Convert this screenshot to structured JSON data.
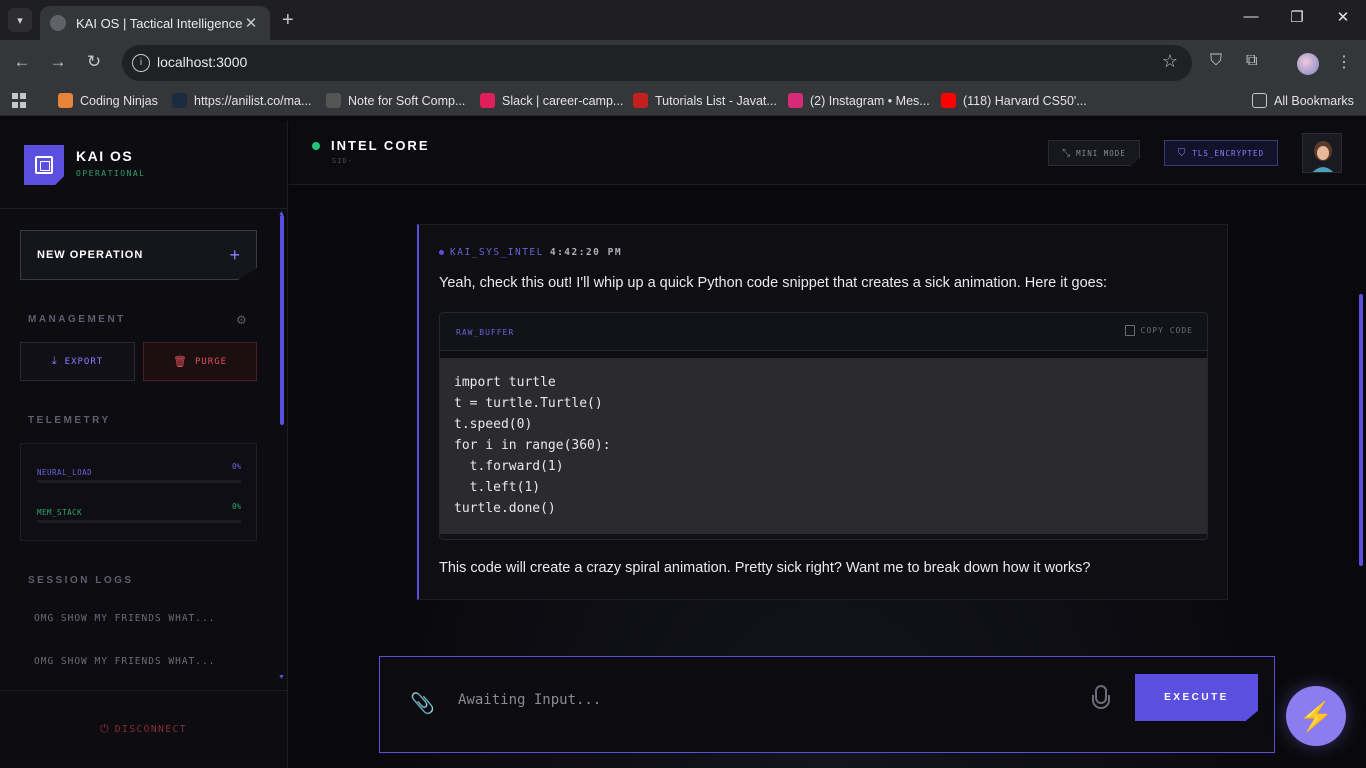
{
  "browser": {
    "tab_title": "KAI OS | Tactical Intelligence",
    "url": "localhost:3000",
    "bookmarks": [
      {
        "label": "Coding Ninjas",
        "color": "#e8833a"
      },
      {
        "label": "https://anilist.co/ma...",
        "color": "#1b2b40"
      },
      {
        "label": "Note for Soft Comp...",
        "color": "#555555"
      },
      {
        "label": "Slack | career-camp...",
        "color": "#e01e5a"
      },
      {
        "label": "Tutorials List - Javat...",
        "color": "#c21f1f"
      },
      {
        "label": "(2) Instagram • Mes...",
        "color": "#d62976"
      },
      {
        "label": "(118) Harvard CS50'...",
        "color": "#ff0000"
      }
    ],
    "all_bookmarks": "All Bookmarks"
  },
  "sidebar": {
    "brand_name": "KAI OS",
    "brand_status": "OPERATIONAL",
    "new_operation": "NEW OPERATION",
    "management_title": "MANAGEMENT",
    "export_label": "EXPORT",
    "purge_label": "PURGE",
    "telemetry_title": "TELEMETRY",
    "telemetry": [
      {
        "label": "NEURAL_LOAD",
        "value": "0%",
        "color": "#6a62d8"
      },
      {
        "label": "MEM_STACK",
        "value": "0%",
        "color": "#2fa36b"
      }
    ],
    "session_logs_title": "SESSION LOGS",
    "session_logs": [
      "OMG SHOW MY FRIENDS WHAT...",
      "OMG SHOW MY FRIENDS WHAT..."
    ],
    "disconnect": "DISCONNECT"
  },
  "header": {
    "title": "INTEL CORE",
    "subtitle": "SID-",
    "mini_mode": "MINI MODE",
    "tls": "TLS_ENCRYPTED"
  },
  "message": {
    "sender": "KAI_SYS_INTEL",
    "time": "4:42:20 PM",
    "intro": "Yeah, check this out! I'll whip up a quick Python code snippet that creates a sick animation. Here it goes:",
    "code_label": "RAW_BUFFER",
    "copy_label": "COPY CODE",
    "code_lines": [
      "import turtle",
      "t = turtle.Turtle()",
      "t.speed(0)",
      "for i in range(360):",
      "  t.forward(1)",
      "  t.left(1)",
      "turtle.done()"
    ],
    "outro": "This code will create a crazy spiral animation. Pretty sick right? Want me to break down how it works?"
  },
  "composer": {
    "placeholder": "Awaiting Input...",
    "execute_label": "EXECUTE"
  },
  "colors": {
    "accent": "#5b4fe0",
    "status_green": "#22c47a",
    "danger": "#8a2c34"
  }
}
